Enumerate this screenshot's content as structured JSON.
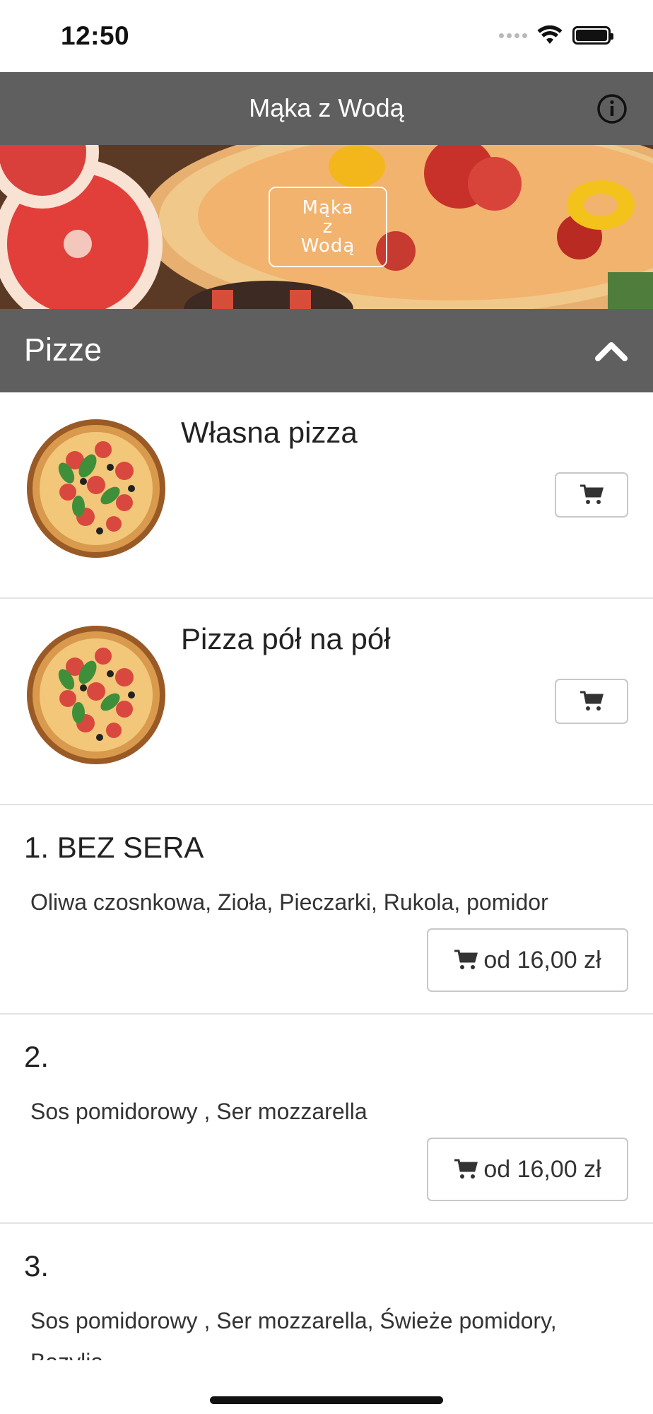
{
  "status_bar": {
    "time": "12:50",
    "icons": [
      "signal-dots-icon",
      "wifi-icon",
      "battery-icon"
    ]
  },
  "header": {
    "title": "Mąka z Wodą",
    "info_icon": "info-icon"
  },
  "banner": {
    "logo_lines": [
      "Mąka",
      "z",
      "Wodą"
    ]
  },
  "category": {
    "title": "Pizze",
    "toggle_icon": "chevron-up-icon"
  },
  "items": [
    {
      "name": "Własna pizza",
      "has_image": true,
      "cart_icon": "cart-icon"
    },
    {
      "name": "Pizza pół na pół",
      "has_image": true,
      "cart_icon": "cart-icon"
    },
    {
      "name": "1. BEZ SERA",
      "description": "Oliwa czosnkowa, Zioła, Pieczarki, Rukola, pomidor",
      "price": "od 16,00 zł"
    },
    {
      "name": "2.",
      "description": "Sos pomidorowy , Ser mozzarella",
      "price": "od 16,00 zł"
    },
    {
      "name": "3.",
      "description": "Sos pomidorowy , Ser mozzarella, Świeże pomidory, Bazylia"
    }
  ],
  "colors": {
    "header_bg": "#5f5f5f",
    "divider": "#e3e3e3",
    "button_border": "#c8c8c8"
  }
}
